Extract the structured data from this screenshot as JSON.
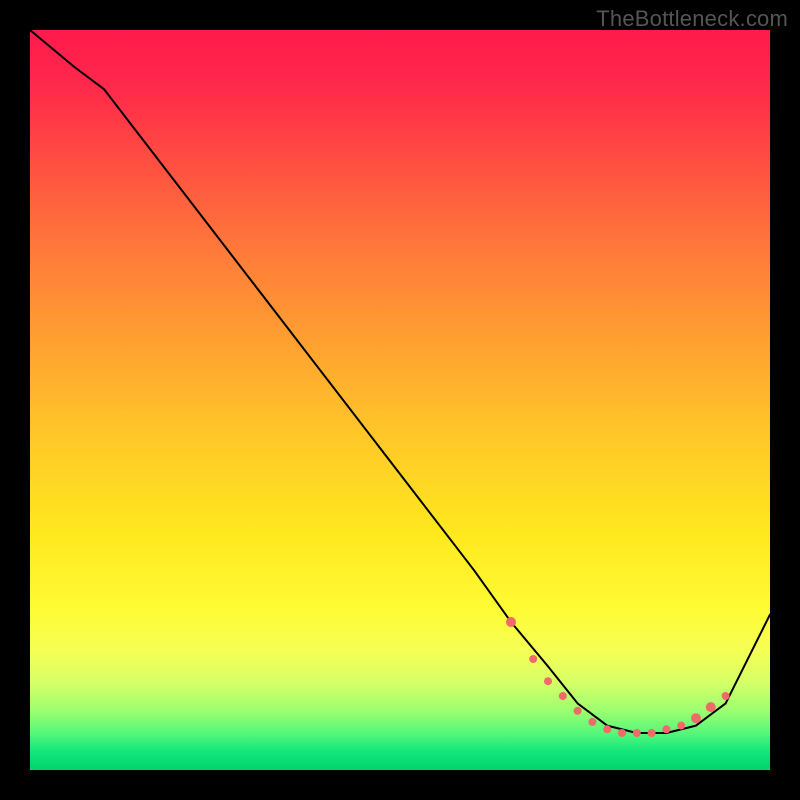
{
  "watermark": "TheBottleneck.com",
  "chart_data": {
    "type": "line",
    "title": "",
    "xlabel": "",
    "ylabel": "",
    "xlim": [
      0,
      100
    ],
    "ylim": [
      0,
      100
    ],
    "grid": false,
    "legend": false,
    "background_gradient": {
      "top": "#ff1a4d",
      "middle": "#ffe81e",
      "bottom": "#00d46a"
    },
    "series": [
      {
        "name": "curve",
        "x": [
          0,
          6,
          10,
          20,
          30,
          40,
          50,
          60,
          65,
          70,
          74,
          78,
          82,
          86,
          90,
          94,
          100
        ],
        "y": [
          100,
          95,
          92,
          79,
          66,
          53,
          40,
          27,
          20,
          14,
          9,
          6,
          5,
          5,
          6,
          9,
          21
        ]
      }
    ],
    "markers": {
      "name": "highlight-dots",
      "color": "#f06a6a",
      "points": [
        {
          "x": 65,
          "y": 20,
          "r": 5
        },
        {
          "x": 68,
          "y": 15,
          "r": 4
        },
        {
          "x": 70,
          "y": 12,
          "r": 4
        },
        {
          "x": 72,
          "y": 10,
          "r": 4
        },
        {
          "x": 74,
          "y": 8,
          "r": 4
        },
        {
          "x": 76,
          "y": 6.5,
          "r": 4
        },
        {
          "x": 78,
          "y": 5.5,
          "r": 4
        },
        {
          "x": 80,
          "y": 5,
          "r": 4
        },
        {
          "x": 82,
          "y": 5,
          "r": 4
        },
        {
          "x": 84,
          "y": 5,
          "r": 4
        },
        {
          "x": 86,
          "y": 5.5,
          "r": 4
        },
        {
          "x": 88,
          "y": 6,
          "r": 4
        },
        {
          "x": 90,
          "y": 7,
          "r": 5
        },
        {
          "x": 92,
          "y": 8.5,
          "r": 5
        },
        {
          "x": 94,
          "y": 10,
          "r": 4
        }
      ]
    }
  }
}
